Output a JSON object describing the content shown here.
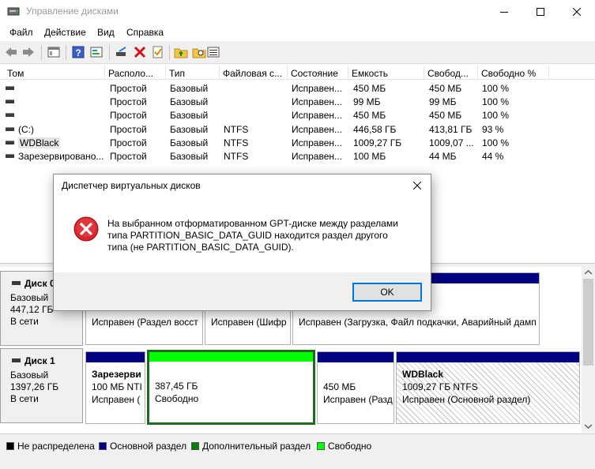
{
  "window": {
    "title": "Управление дисками"
  },
  "menu": [
    "Файл",
    "Действие",
    "Вид",
    "Справка"
  ],
  "colors": {
    "primary": "#000080",
    "extended": "#008000",
    "free": "#00ff00",
    "unallocated": "#000000",
    "selected_border": "#1e6b1e"
  },
  "volumes": {
    "columns": [
      "Том",
      "Располо...",
      "Тип",
      "Файловая с...",
      "Состояние",
      "Емкость",
      "Свобод...",
      "Свободно %"
    ],
    "rows": [
      [
        "",
        "Простой",
        "Базовый",
        "",
        "Исправен...",
        "450 МБ",
        "450 МБ",
        "100 %"
      ],
      [
        "",
        "Простой",
        "Базовый",
        "",
        "Исправен...",
        "99 МБ",
        "99 МБ",
        "100 %"
      ],
      [
        "",
        "Простой",
        "Базовый",
        "",
        "Исправен...",
        "450 МБ",
        "450 МБ",
        "100 %"
      ],
      [
        "(C:)",
        "Простой",
        "Базовый",
        "NTFS",
        "Исправен...",
        "446,58 ГБ",
        "413,81 ГБ",
        "93 %"
      ],
      [
        "WDBlack",
        "Простой",
        "Базовый",
        "NTFS",
        "Исправен...",
        "1009,27 ГБ",
        "1009,07 ...",
        "100 %"
      ],
      [
        "Зарезервировано...",
        "Простой",
        "Базовый",
        "NTFS",
        "Исправен...",
        "100 МБ",
        "44 МБ",
        "44 %"
      ]
    ]
  },
  "disks": [
    {
      "name": "Диск 0",
      "type": "Базовый",
      "size": "447,12 ГБ",
      "status": "В сети",
      "partitions": [
        {
          "line1": "Исправен (Раздел восст"
        },
        {
          "line1": "Исправен (Шифр"
        },
        {
          "line1": "Исправен (Загрузка, Файл подкачки, Аварийный дамп"
        }
      ]
    },
    {
      "name": "Диск 1",
      "type": "Базовый",
      "size": "1397,26 ГБ",
      "status": "В сети",
      "partitions": [
        {
          "title": "Зарезерви",
          "line1": "100 МБ NTI",
          "line2": "Исправен ("
        },
        {
          "line1": "387,45 ГБ",
          "line2": "Свободно"
        },
        {
          "line1": "450 МБ",
          "line2": "Исправен (Разд"
        },
        {
          "title": "WDBlack",
          "line1": "1009,27 ГБ NTFS",
          "line2": "Исправен (Основной раздел)"
        }
      ]
    }
  ],
  "legend": [
    "Не распределена",
    "Основной раздел",
    "Дополнительный раздел",
    "Свободно"
  ],
  "dialog": {
    "title": "Диспетчер виртуальных дисков",
    "message": "На выбранном отформатированном GPT-диске между разделами типа PARTITION_BASIC_DATA_GUID находится раздел другого типа (не PARTITION_BASIC_DATA_GUID).",
    "ok_label": "OK"
  }
}
